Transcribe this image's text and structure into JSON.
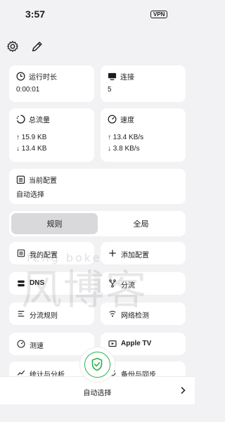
{
  "status_bar": {
    "time": "3:57",
    "vpn_badge": "VPN"
  },
  "top_icons": [
    "gear-icon",
    "pencil-icon"
  ],
  "stats": {
    "runtime": {
      "title": "运行时长",
      "value": "0:00:01",
      "icon": "clock-icon"
    },
    "connections": {
      "title": "连接",
      "value": "5",
      "icon": "monitor-icon"
    },
    "traffic": {
      "title": "总流量",
      "up": "↑ 15.9 KB",
      "down": "↓ 13.4 KB",
      "icon": "ring-icon"
    },
    "speed": {
      "title": "速度",
      "up": "↑ 13.4 KB/s",
      "down": "↓ 3.8 KB/s",
      "icon": "gauge-icon"
    }
  },
  "current_config": {
    "title": "当前配置",
    "value": "自动选择",
    "icon": "list-icon"
  },
  "mode_segment": {
    "options": [
      "规则",
      "全局"
    ],
    "selected": "规则"
  },
  "tiles": [
    {
      "label": "我的配置",
      "icon": "list-icon"
    },
    {
      "label": "添加配置",
      "icon": "plus-icon"
    },
    {
      "label": "DNS",
      "icon": "server-icon"
    },
    {
      "label": "分流",
      "icon": "fork-icon"
    },
    {
      "label": "分流规则",
      "icon": "rules-icon"
    },
    {
      "label": "网络检测",
      "icon": "network-icon"
    },
    {
      "label": "测速",
      "icon": "gauge-icon"
    },
    {
      "label": "Apple TV",
      "icon": "tv-icon"
    },
    {
      "label": "统计与分析",
      "icon": "chart-icon"
    },
    {
      "label": "备份与同步",
      "icon": "sync-icon"
    }
  ],
  "bottom_bar": {
    "label": "自动选择",
    "chevron": "chevron-right-icon"
  },
  "connect_button": {
    "icon": "shield-check-icon",
    "accent": "#2fb24a"
  },
  "watermark": {
    "text": "风博客",
    "latin": "feng boke"
  }
}
